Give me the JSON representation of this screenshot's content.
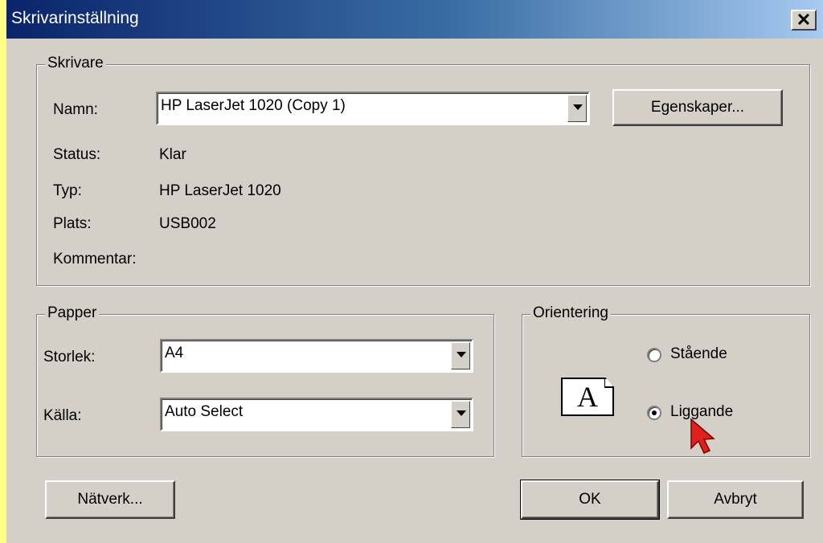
{
  "window": {
    "title": "Skrivarinställning",
    "close_label": "✕"
  },
  "printer": {
    "legend": "Skrivare",
    "name_label": "Namn:",
    "name_value": "HP LaserJet 1020 (Copy 1)",
    "properties_button": "Egenskaper...",
    "status_label": "Status:",
    "status_value": "Klar",
    "type_label": "Typ:",
    "type_value": "HP LaserJet 1020",
    "location_label": "Plats:",
    "location_value": "USB002",
    "comment_label": "Kommentar:",
    "comment_value": ""
  },
  "paper": {
    "legend": "Papper",
    "size_label": "Storlek:",
    "size_value": "A4",
    "source_label": "Källa:",
    "source_value": "Auto Select"
  },
  "orientation": {
    "legend": "Orientering",
    "preview_letter": "A",
    "portrait_label": "Stående",
    "portrait_selected": false,
    "landscape_label": "Liggande",
    "landscape_selected": true
  },
  "footer": {
    "network_button": "Nätverk...",
    "ok_button": "OK",
    "cancel_button": "Avbryt"
  },
  "icons": [
    "close-icon",
    "dropdown-arrow-icon",
    "page-preview-icon",
    "mouse-cursor-icon"
  ],
  "colors": {
    "titlebar_start": "#0a246a",
    "titlebar_end": "#a6caf0",
    "dialog_bg": "#d4d0c8",
    "desktop_bg": "#ffff88",
    "cursor": "#e0201c"
  }
}
